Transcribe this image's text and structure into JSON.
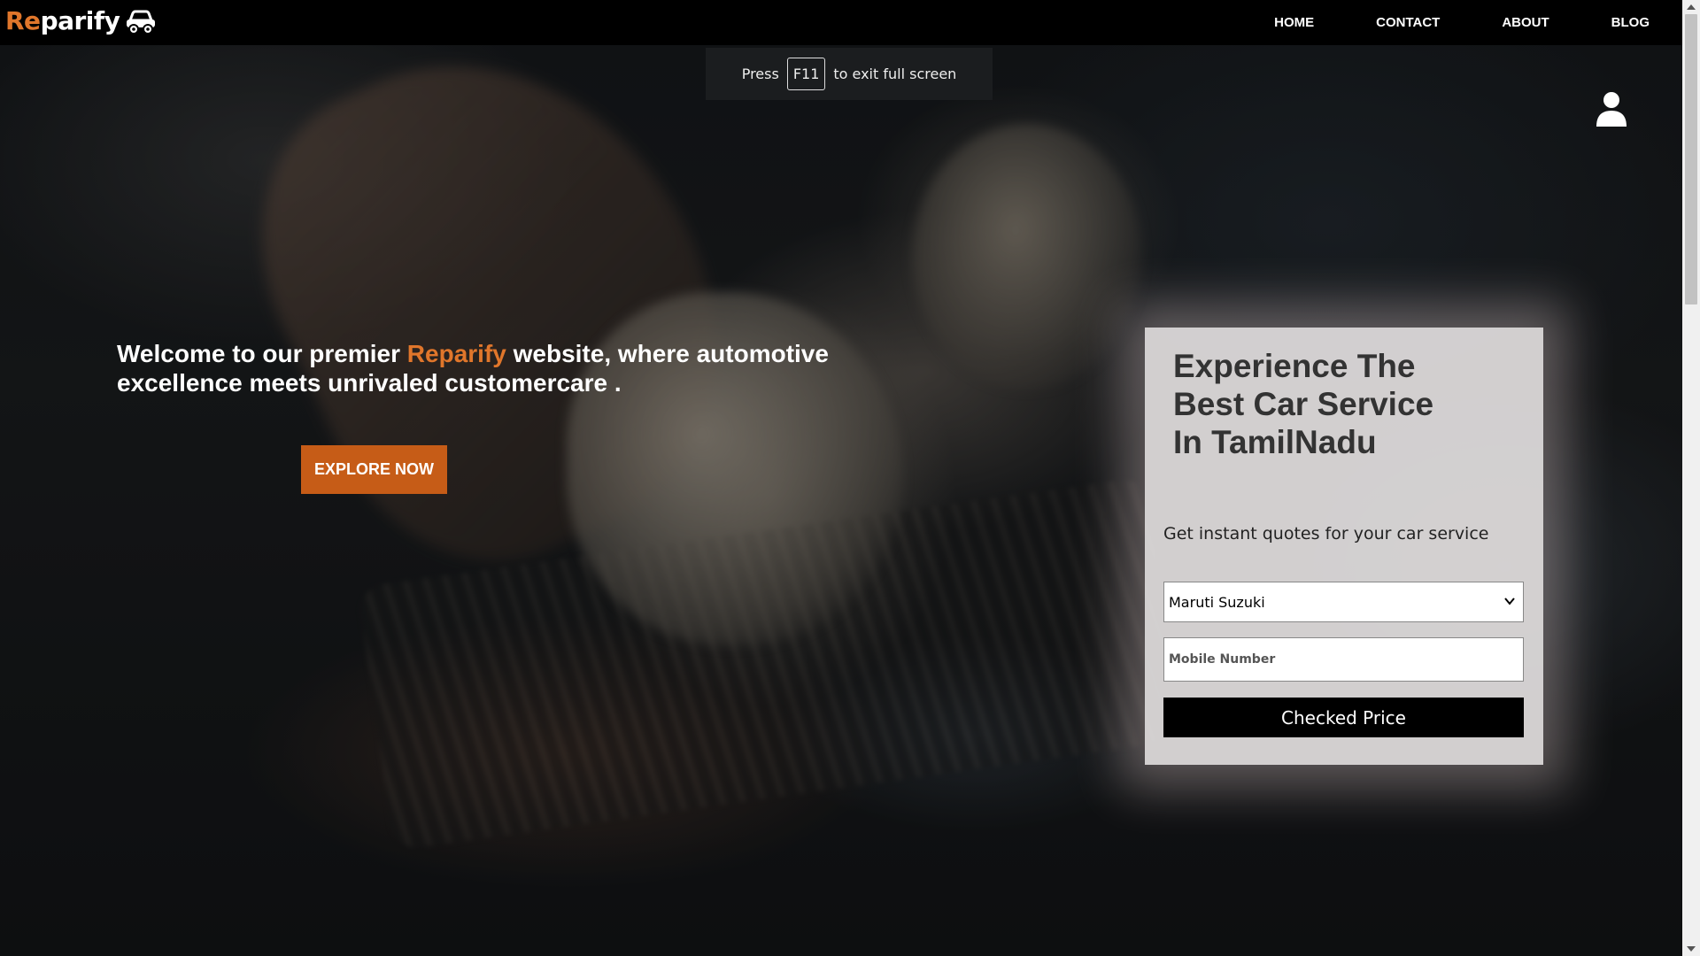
{
  "brand": {
    "logo_accent": "Re",
    "logo_rest": "parify",
    "logo_icon": "car-icon",
    "accent_color": "#e0762b"
  },
  "nav": {
    "items": [
      {
        "label": "HOME"
      },
      {
        "label": "CONTACT"
      },
      {
        "label": "ABOUT"
      },
      {
        "label": "BLOG"
      }
    ]
  },
  "fullscreen_toast": {
    "before": "Press",
    "key": "F11",
    "after": "to exit full screen"
  },
  "user_icon": "user-icon",
  "hero": {
    "text_before": "Welcome to our premier ",
    "text_accent": "Reparify",
    "text_after": " website, where automotive excellence meets unrivaled customercare .",
    "button_label": "EXPLORE NOW",
    "button_color": "#c65c17"
  },
  "quote_card": {
    "title": "Experience The Best Car Service In TamilNadu",
    "subtitle": "Get instant quotes for your car service",
    "select_value": "Maruti Suzuki",
    "mobile_placeholder": "Mobile Number",
    "submit_label": "Checked Price"
  }
}
